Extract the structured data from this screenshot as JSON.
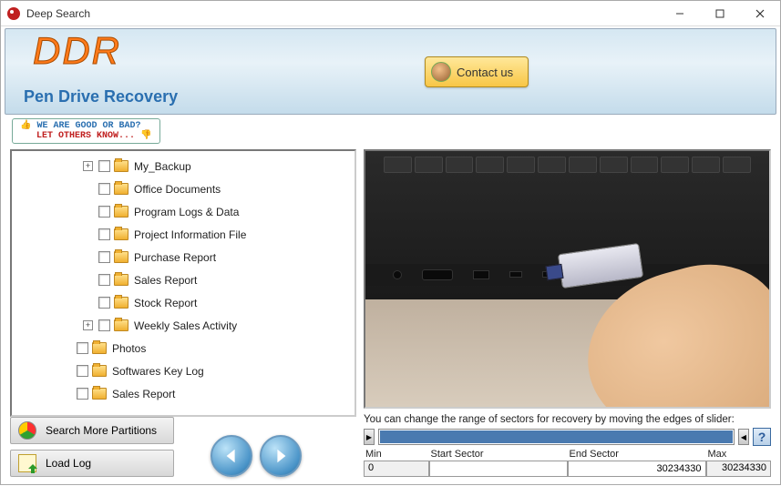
{
  "window": {
    "title": "Deep Search"
  },
  "header": {
    "logo": "DDR",
    "subtitle": "Pen Drive Recovery",
    "contact": "Contact us"
  },
  "feedback": {
    "line1": "WE ARE GOOD OR BAD?",
    "line2": "LET OTHERS KNOW..."
  },
  "tree": [
    {
      "indent": 3,
      "expander": "+",
      "label": "My_Backup"
    },
    {
      "indent": 3,
      "expander": "",
      "label": "Office Documents"
    },
    {
      "indent": 3,
      "expander": "",
      "label": "Program Logs & Data"
    },
    {
      "indent": 3,
      "expander": "",
      "label": "Project Information File"
    },
    {
      "indent": 3,
      "expander": "",
      "label": "Purchase Report"
    },
    {
      "indent": 3,
      "expander": "",
      "label": "Sales Report"
    },
    {
      "indent": 3,
      "expander": "",
      "label": "Stock Report"
    },
    {
      "indent": 3,
      "expander": "+",
      "label": "Weekly Sales Activity"
    },
    {
      "indent": 2,
      "expander": "",
      "label": "Photos"
    },
    {
      "indent": 2,
      "expander": "",
      "label": "Softwares Key Log"
    },
    {
      "indent": 2,
      "expander": "",
      "label": "Sales Report"
    }
  ],
  "buttons": {
    "searchMore": "Search More Partitions",
    "loadLog": "Load Log"
  },
  "slider": {
    "caption": "You can change the range of sectors for recovery by moving the edges of slider:",
    "help": "?",
    "cols": {
      "minLabel": "Min",
      "min": "0",
      "startLabel": "Start Sector",
      "start": "",
      "endLabel": "End Sector",
      "end": "30234330",
      "maxLabel": "Max",
      "max": "30234330"
    }
  }
}
